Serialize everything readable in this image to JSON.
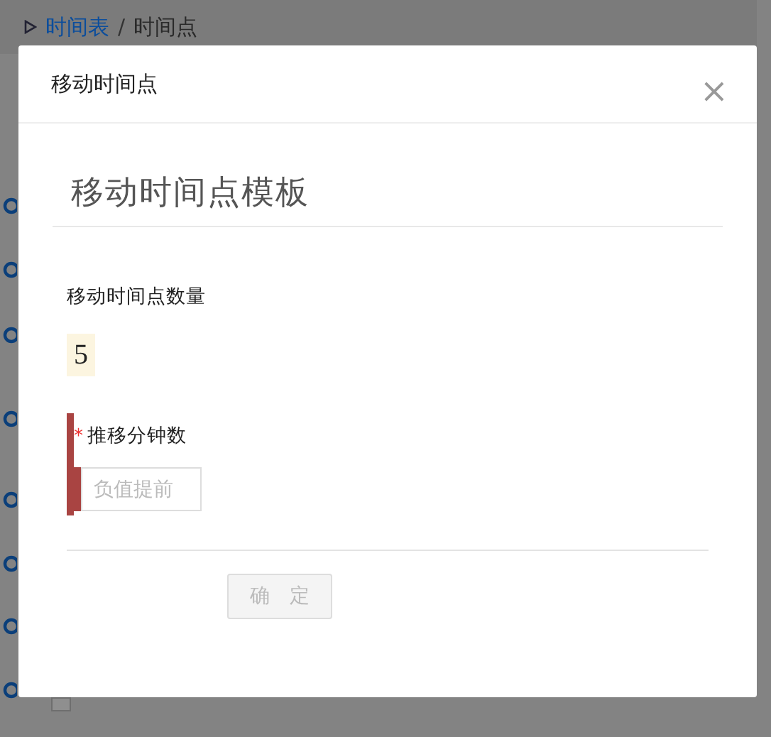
{
  "breadcrumb_separator": "/",
  "background_row": {
    "checked": false
  },
  "breadcrumb": [
    {
      "label": "时间表",
      "kind": "link"
    },
    {
      "label": "时间点",
      "kind": "current"
    }
  ],
  "dialog": {
    "title": "移动时间点",
    "close": "×",
    "section_title": "移动时间点模板",
    "count_label": "移动时间点数量",
    "count_value": "5",
    "field": {
      "label": "推移分钟数",
      "required": true,
      "required_mark": "*",
      "placeholder": "负值提前"
    },
    "submit": {
      "label": "确　定",
      "disabled": true
    }
  }
}
